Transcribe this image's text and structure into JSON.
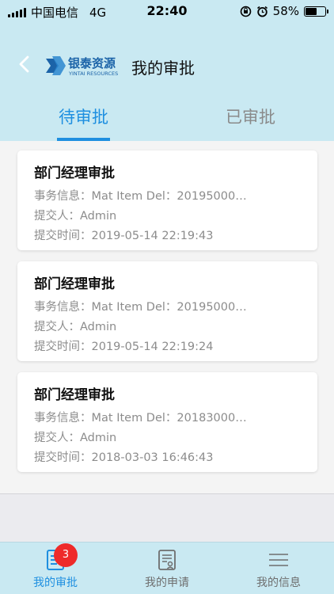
{
  "status_bar": {
    "carrier": "中国电信",
    "network": "4G",
    "time": "22:40",
    "battery_percent": "58%",
    "battery_level": 0.58
  },
  "header": {
    "title": "我的审批",
    "logo_text": "银泰资源",
    "logo_subtext": "YINTAI RESOURCES"
  },
  "tabs": [
    {
      "label": "待审批",
      "active": true
    },
    {
      "label": "已审批",
      "active": false
    }
  ],
  "approvals": [
    {
      "title": "部门经理审批",
      "info": "事务信息：Mat Item Del：20195000…",
      "submitter": "提交人：Admin",
      "submit_time": "提交时间：2019-05-14 22:19:43"
    },
    {
      "title": "部门经理审批",
      "info": "事务信息：Mat Item Del：20195000…",
      "submitter": "提交人：Admin",
      "submit_time": "提交时间：2019-05-14 22:19:24"
    },
    {
      "title": "部门经理审批",
      "info": "事务信息：Mat Item Del：20183000…",
      "submitter": "提交人：Admin",
      "submit_time": "提交时间：2018-03-03 16:46:43"
    }
  ],
  "tab_bar": {
    "items": [
      {
        "label": "我的审批",
        "badge": "3",
        "icon": "approval-doc-icon",
        "active": true
      },
      {
        "label": "我的申请",
        "icon": "application-doc-icon",
        "active": false
      },
      {
        "label": "我的信息",
        "icon": "menu-lines-icon",
        "active": false
      }
    ]
  },
  "colors": {
    "header_bg": "#c9e9f2",
    "accent": "#1e8fe0",
    "badge": "#ee2a2a"
  }
}
